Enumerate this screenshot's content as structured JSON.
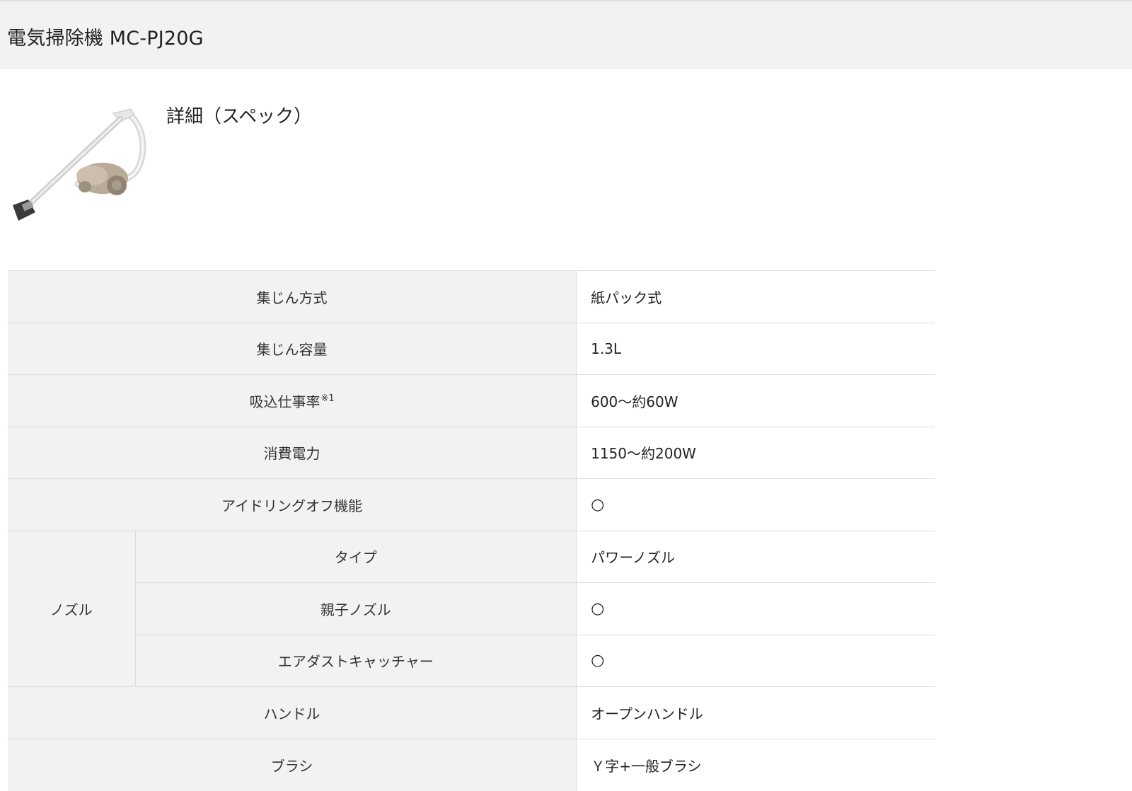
{
  "header": {
    "title": "電気掃除機 MC-PJ20G"
  },
  "section": {
    "title": "詳細（スペック）"
  },
  "product": {
    "image_icon": "vacuum-cleaner-icon"
  },
  "specs": {
    "collection_method": {
      "label": "集じん方式",
      "value": "紙パック式"
    },
    "dust_capacity": {
      "label": "集じん容量",
      "value": "1.3L"
    },
    "suction_power": {
      "label": "吸込仕事率",
      "note": "※1",
      "value": "600～約60W"
    },
    "power_consumption": {
      "label": "消費電力",
      "value": "1150～約200W"
    },
    "idling_off": {
      "label": "アイドリングオフ機能",
      "value": "○"
    },
    "nozzle": {
      "group_label": "ノズル",
      "type": {
        "label": "タイプ",
        "value": "パワーノズル"
      },
      "parent_child": {
        "label": "親子ノズル",
        "value": "○"
      },
      "air_dust_catcher": {
        "label": "エアダストキャッチャー",
        "value": "○"
      }
    },
    "handle": {
      "label": "ハンドル",
      "value": "オープンハンドル"
    },
    "brush": {
      "label": "ブラシ",
      "value": "Ｙ字+一般ブラシ"
    }
  }
}
